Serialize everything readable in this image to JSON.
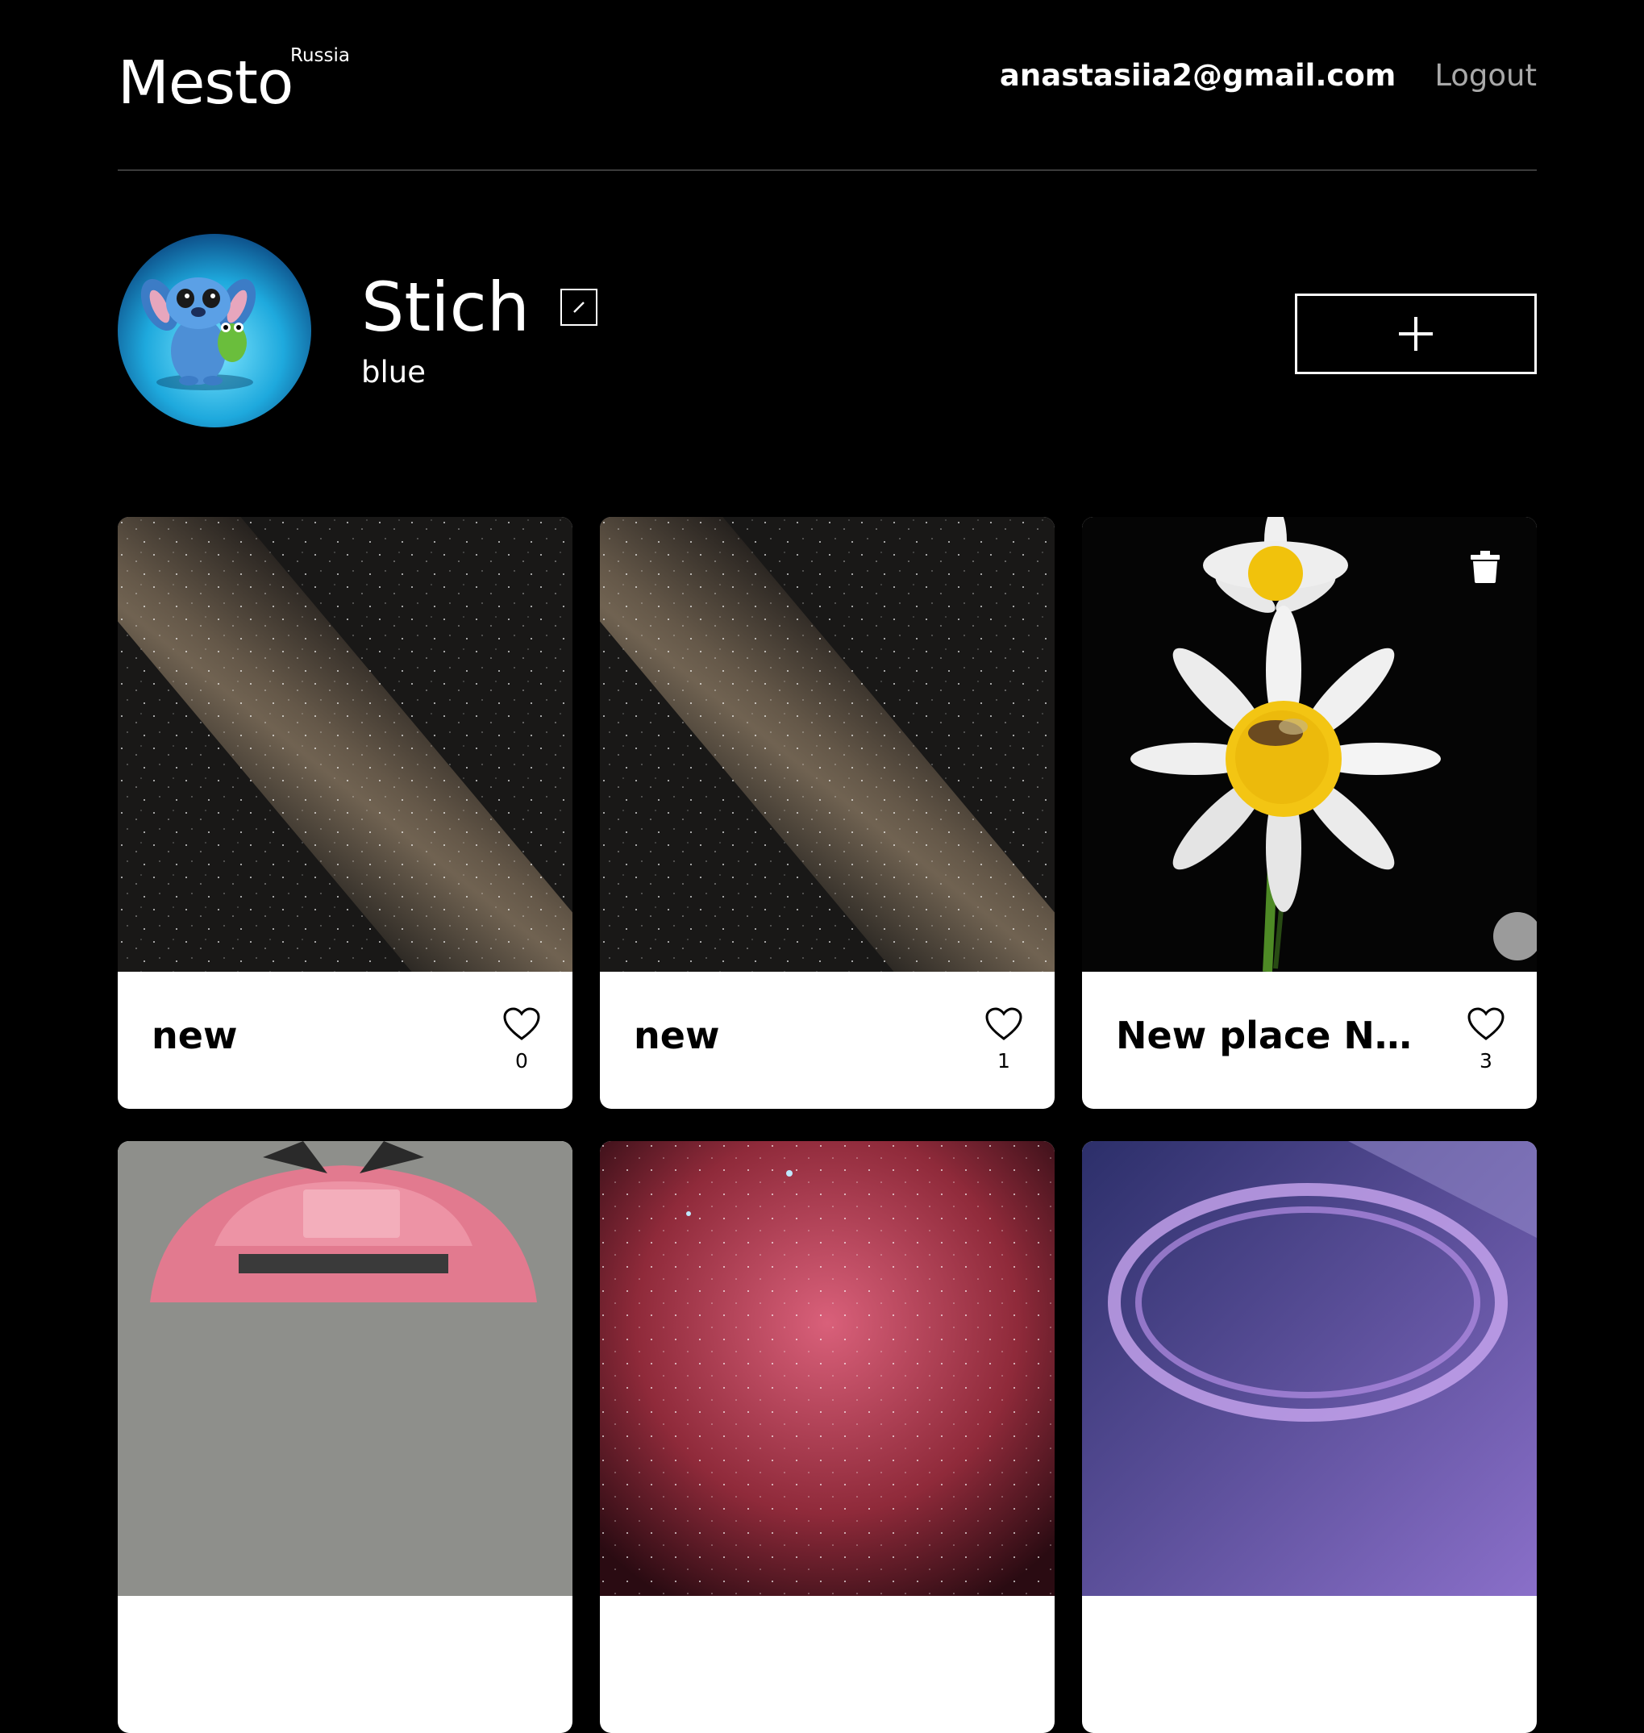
{
  "header": {
    "logo": "Mesto",
    "region": "Russia",
    "email": "anastasiia2@gmail.com",
    "logout": "Logout"
  },
  "profile": {
    "name": "Stich",
    "about": "blue"
  },
  "cards": [
    {
      "title": "new",
      "likes": "0"
    },
    {
      "title": "new",
      "likes": "1"
    },
    {
      "title": "New place New ...",
      "likes": "3"
    }
  ],
  "colors": {
    "background": "#000000",
    "accent": "#ffffff",
    "muted": "#a9a9a9"
  },
  "icons": [
    "edit-pencil-icon",
    "plus-icon",
    "heart-icon",
    "trash-icon"
  ]
}
